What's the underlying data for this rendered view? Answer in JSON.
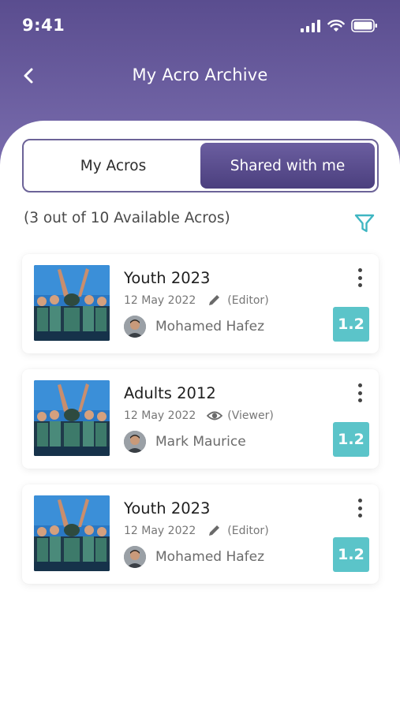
{
  "status_bar": {
    "time": "9:41"
  },
  "nav": {
    "title": "My Acro Archive"
  },
  "tabs": [
    {
      "label": "My Acros",
      "active": false
    },
    {
      "label": "Shared with me",
      "active": true
    }
  ],
  "summary": {
    "count_text": "(3 out of 10 Available Acros)"
  },
  "colors": {
    "header_top": "#5a4d8f",
    "header_bottom": "#7c6fb0",
    "accent_teal": "#5bc4c9",
    "filter_icon": "#3fb6c2"
  },
  "acros": [
    {
      "title": "Youth 2023",
      "date": "12 May 2022",
      "role_icon": "pencil-icon",
      "role": "(Editor)",
      "owner": "Mohamed Hafez",
      "version": "1.2"
    },
    {
      "title": "Adults 2012",
      "date": "12 May 2022",
      "role_icon": "eye-icon",
      "role": "(Viewer)",
      "owner": "Mark Maurice",
      "version": "1.2"
    },
    {
      "title": "Youth 2023",
      "date": "12 May 2022",
      "role_icon": "pencil-icon",
      "role": "(Editor)",
      "owner": "Mohamed Hafez",
      "version": "1.2"
    }
  ]
}
